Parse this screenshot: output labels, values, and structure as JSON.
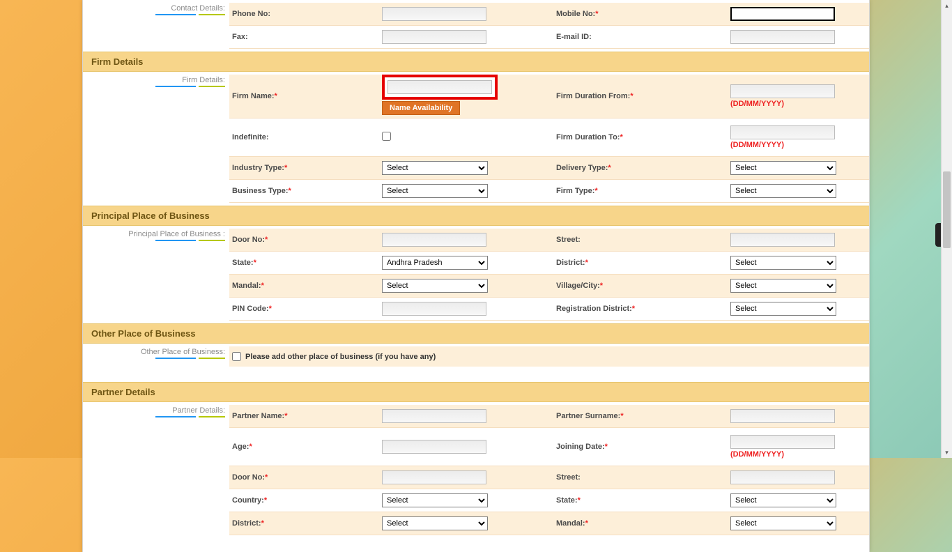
{
  "sidebar": {
    "contact_details": "Contact Details:",
    "firm_details": "Firm Details:",
    "principal_place": "Principal Place of Business :",
    "other_place": "Other Place of Business:",
    "partner_details": "Partner Details:"
  },
  "sections": {
    "firm_details": "Firm Details",
    "principal_place": "Principal Place of Business",
    "other_place": "Other Place of Business",
    "partner_details": "Partner Details"
  },
  "contact": {
    "phone_label": "Phone No:",
    "mobile_label": "Mobile No:",
    "fax_label": "Fax:",
    "email_label": "E-mail ID:"
  },
  "firm": {
    "name_label": "Firm Name:",
    "name_availability": "Name Availability",
    "duration_from_label": "Firm Duration From:",
    "duration_to_label": "Firm Duration To:",
    "indefinite_label": "Indefinite:",
    "industry_type_label": "Industry Type:",
    "delivery_type_label": "Delivery Type:",
    "business_type_label": "Business Type:",
    "firm_type_label": "Firm Type:",
    "date_hint": "(DD/MM/YYYY)"
  },
  "place": {
    "door_label": "Door No:",
    "street_label": "Street:",
    "state_label": "State:",
    "district_label": "District:",
    "mandal_label": "Mandal:",
    "village_label": "Village/City:",
    "pin_label": "PIN Code:",
    "reg_district_label": "Registration District:",
    "state_value": "Andhra Pradesh"
  },
  "other": {
    "checkbox_label": "Please add other place of business (if you have any)"
  },
  "partner": {
    "name_label": "Partner Name:",
    "surname_label": "Partner Surname:",
    "age_label": "Age:",
    "joining_label": "Joining Date:",
    "door_label": "Door No:",
    "street_label": "Street:",
    "country_label": "Country:",
    "state_label": "State:",
    "district_label": "District:",
    "mandal_label": "Mandal:"
  },
  "select_default": "Select",
  "asterisk": "*"
}
